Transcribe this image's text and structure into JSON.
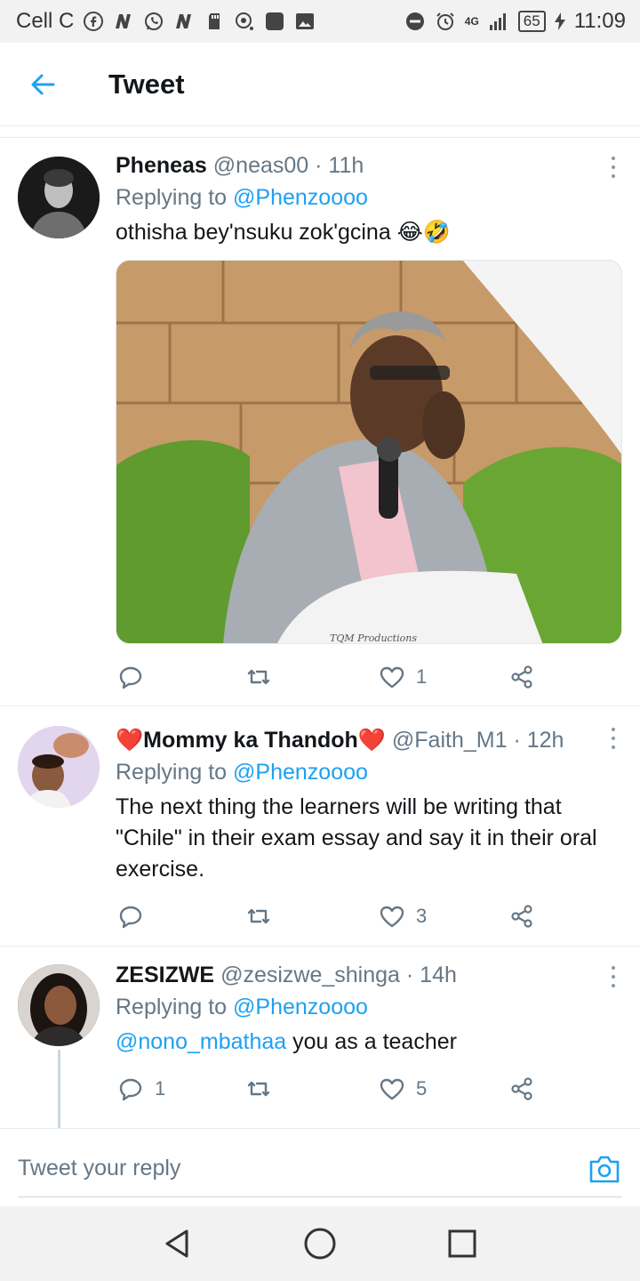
{
  "status_bar": {
    "carrier": "Cell C",
    "network": "4G",
    "battery": "65",
    "time": "11:09"
  },
  "header": {
    "title": "Tweet"
  },
  "tweets": [
    {
      "name": "Pheneas",
      "handle": "@neas00",
      "time": "· 11h",
      "replying_prefix": "Replying to",
      "replying_to": "@Phenzoooo",
      "text": "othisha bey'nsuku zok'gcina 😂🤣",
      "media_caption": "TQM Productions",
      "replies": "",
      "retweets": "",
      "likes": "1"
    },
    {
      "name": "❤️Mommy ka Thandoh❤️",
      "handle": "@Faith_M1",
      "time": "· 12h",
      "replying_prefix": "Replying to",
      "replying_to": "@Phenzoooo",
      "text": "The next thing the learners will be writing that \"Chile\" in their exam essay and say it in their oral exercise.",
      "replies": "",
      "retweets": "",
      "likes": "3"
    },
    {
      "name": "ZESIZWE",
      "handle": "@zesizwe_shinga",
      "time": "· 14h",
      "replying_prefix": "Replying to",
      "replying_to": "@Phenzoooo",
      "text_mention": "@nono_mbathaa",
      "text": " you as a teacher",
      "replies": "1",
      "retweets": "",
      "likes": "5"
    }
  ],
  "composer": {
    "placeholder": "Tweet your reply"
  },
  "colors": {
    "accent": "#1da1f2",
    "secondary_text": "#657786",
    "primary_text": "#14171a"
  }
}
